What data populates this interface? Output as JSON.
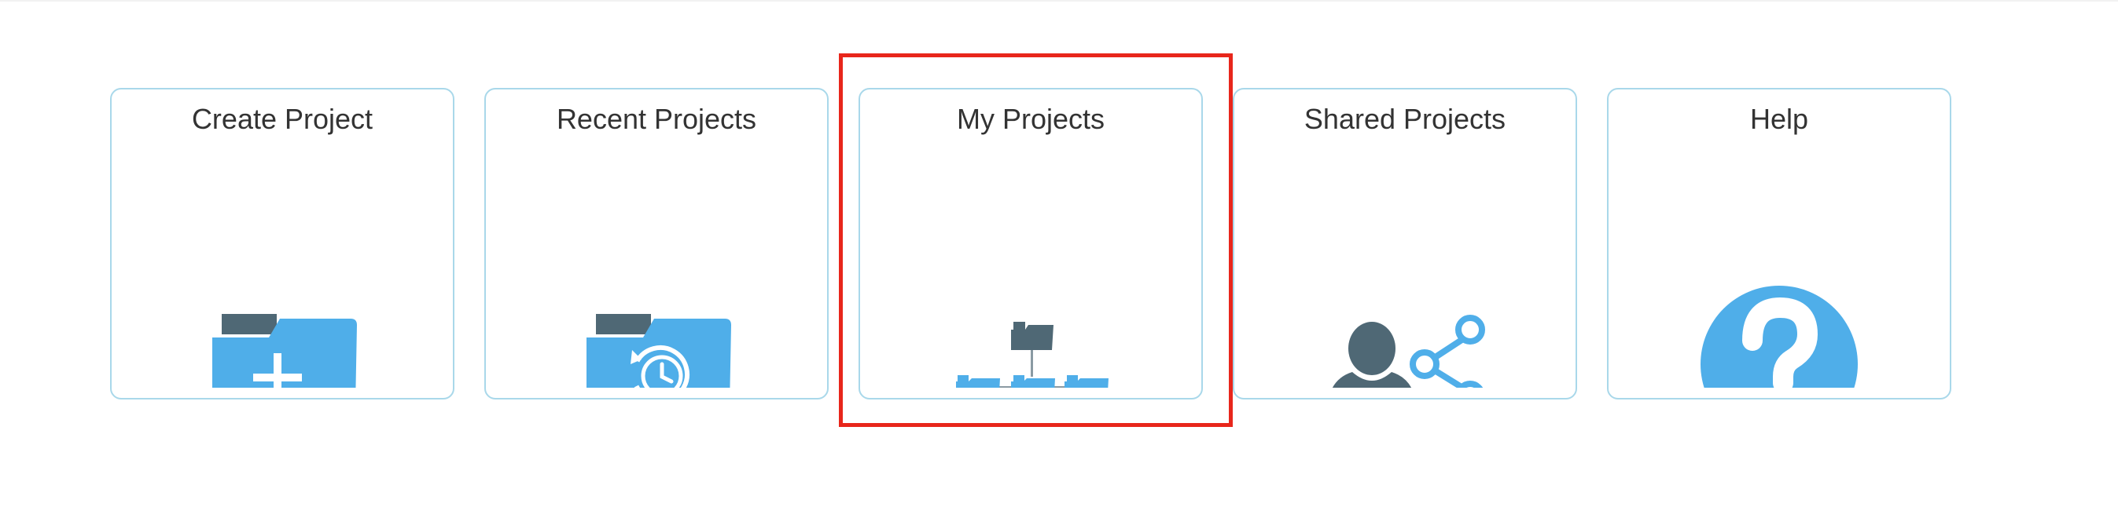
{
  "colors": {
    "card_border": "#a9d8ea",
    "icon_blue": "#4faee9",
    "icon_dark": "#4f6875",
    "highlight": "#e8261b",
    "title_text": "#333333"
  },
  "cards": [
    {
      "label": "Create Project",
      "icon": "folder-plus-icon"
    },
    {
      "label": "Recent Projects",
      "icon": "folder-history-icon"
    },
    {
      "label": "My Projects",
      "icon": "folder-tree-icon",
      "highlighted": true
    },
    {
      "label": "Shared Projects",
      "icon": "user-share-icon"
    },
    {
      "label": "Help",
      "icon": "help-icon"
    }
  ]
}
